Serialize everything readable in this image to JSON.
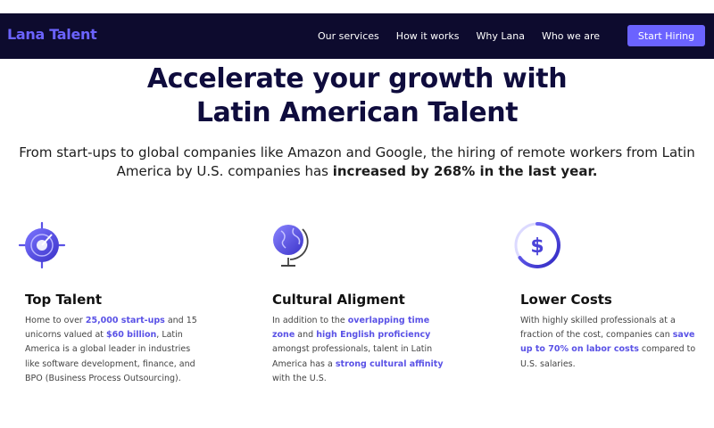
{
  "nav": {
    "logo": "Lana Talent",
    "links": [
      "Our services",
      "How it works",
      "Why Lana",
      "Who we are"
    ],
    "cta": "Start Hiring"
  },
  "hero": {
    "title_line1": "Accelerate your growth with",
    "title_line2": "Latin American Talent",
    "subtitle_line1": "From start-ups to global companies like Amazon and Google, the hiring of remote workers from Latin",
    "subtitle_line2_plain": "America by U.S. companies has ",
    "subtitle_line2_bold": "increased by 268% in the last year."
  },
  "features": [
    {
      "icon": "target-icon",
      "title": "Top Talent",
      "text": [
        {
          "t": "Home to over ",
          "hl": false
        },
        {
          "t": "25,000 start-ups",
          "hl": true
        },
        {
          "t": " and 15 unicorns valued at ",
          "hl": false
        },
        {
          "t": "$60 billion",
          "hl": true
        },
        {
          "t": ", Latin America is a global leader in industries like software development, finance, and BPO (Business Process Outsourcing).",
          "hl": false
        }
      ]
    },
    {
      "icon": "globe-icon",
      "title": "Cultural Aligment",
      "text": [
        {
          "t": "In addition to the ",
          "hl": false
        },
        {
          "t": "overlapping time zone",
          "hl": true
        },
        {
          "t": " and ",
          "hl": false
        },
        {
          "t": "high English proficiency",
          "hl": true
        },
        {
          "t": " amongst professionals, talent in Latin America has a ",
          "hl": false
        },
        {
          "t": "strong cultural affinity",
          "hl": true
        },
        {
          "t": " with the U.S.",
          "hl": false
        }
      ]
    },
    {
      "icon": "dollar-icon",
      "title": "Lower Costs",
      "text": [
        {
          "t": "With highly skilled professionals at a fraction of the cost, companies can ",
          "hl": false
        },
        {
          "t": "save up to 70% on labor costs",
          "hl": true
        },
        {
          "t": " compared to U.S. salaries.",
          "hl": false
        }
      ]
    }
  ],
  "colors": {
    "navbar_bg": "#0d0b2e",
    "accent": "#6b63ff",
    "highlight": "#5a52e6",
    "title": "#0f0c3d"
  }
}
